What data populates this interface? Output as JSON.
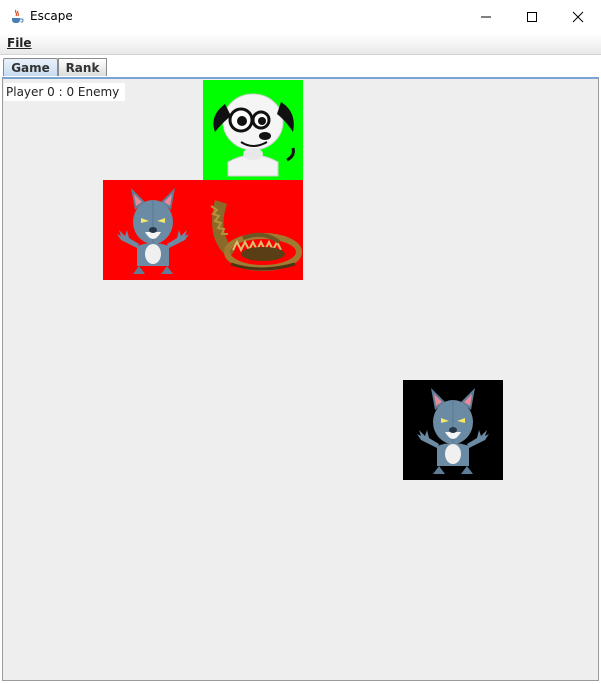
{
  "window": {
    "title": "Escape",
    "app_icon": "java-coffee-icon",
    "controls": [
      "minimize-icon",
      "maximize-icon",
      "close-icon"
    ]
  },
  "menu": {
    "items": [
      {
        "label": "File"
      }
    ]
  },
  "tabs": [
    {
      "label": "Game",
      "selected": true
    },
    {
      "label": "Rank",
      "selected": false
    }
  ],
  "game": {
    "status_text": "Player 0 : 0 Enemy",
    "colors": {
      "player_tile": "#00ff00",
      "enemy_zone": "#ff0000",
      "enemy_tile": "#000000",
      "board": "#eeeeee"
    },
    "sprites": [
      "dog-icon",
      "wolf-icon",
      "bear-trap-icon",
      "wolf-icon"
    ]
  }
}
